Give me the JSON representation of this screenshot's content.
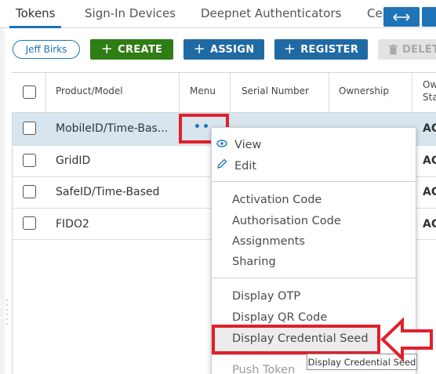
{
  "tabs": [
    {
      "label": "Tokens",
      "active": true
    },
    {
      "label": "Sign-In Devices",
      "active": false
    },
    {
      "label": "Deepnet Authenticators",
      "active": false
    },
    {
      "label": "Ce",
      "active": false
    }
  ],
  "toolbar": {
    "user": "Jeff Birks",
    "create": "CREATE",
    "assign": "ASSIGN",
    "register": "REGISTER",
    "delete": "DELET"
  },
  "table": {
    "headers": {
      "product": "Product/Model",
      "menu": "Menu",
      "serial": "Serial Number",
      "ownership": "Ownership",
      "ow_line1": "Ow",
      "ow_line2": "Sta"
    },
    "rows": [
      {
        "product": "MobileID/Time-Bas...",
        "status": "AC",
        "selected": true
      },
      {
        "product": "GridID",
        "status": "AC",
        "selected": false
      },
      {
        "product": "SafeID/Time-Based",
        "status": "AC",
        "selected": false
      },
      {
        "product": "FIDO2",
        "status": "AC",
        "selected": false
      }
    ],
    "menu_dots": "••"
  },
  "context_menu": {
    "view": "View",
    "edit": "Edit",
    "activation": "Activation Code",
    "authorisation": "Authorisation Code",
    "assignments": "Assignments",
    "sharing": "Sharing",
    "display_otp": "Display OTP",
    "display_qr": "Display QR Code",
    "display_seed": "Display Credential Seed",
    "push_token": "Push Token"
  },
  "tooltip": "Display Credential Seed",
  "colors": {
    "primary": "#1f6aa3",
    "create": "#2f7d15",
    "highlight_red": "#e0202b",
    "selected_row": "#d8e5ef"
  }
}
